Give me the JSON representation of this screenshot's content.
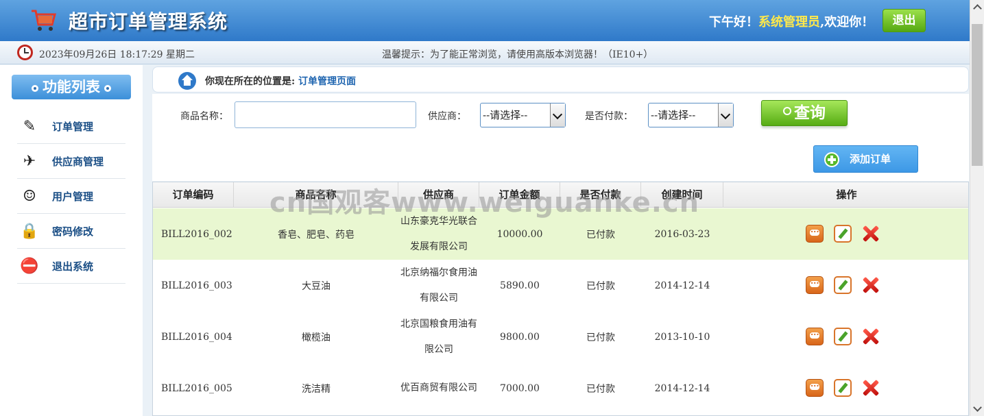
{
  "header": {
    "title": "超市订单管理系统",
    "greeting": "下午好！",
    "username": "系统管理员",
    "welcome": ",欢迎你！",
    "logout_label": "退出"
  },
  "subbar": {
    "datetime": "2023年09月26日 18:17:29 星期二",
    "tip": "温馨提示：为了能正常浏览，请使用高版本浏览器！（IE10+）"
  },
  "sidebar": {
    "title": "功能列表",
    "items": [
      {
        "label": "订单管理",
        "icon": "order-icon"
      },
      {
        "label": "供应商管理",
        "icon": "supplier-icon"
      },
      {
        "label": "用户管理",
        "icon": "users-icon"
      },
      {
        "label": "密码修改",
        "icon": "lock-icon"
      },
      {
        "label": "退出系统",
        "icon": "exit-icon"
      }
    ]
  },
  "breadcrumb": {
    "prefix": "你现在所在的位置是:",
    "current": "订单管理页面"
  },
  "search": {
    "product_label": "商品名称：",
    "product_value": "",
    "provider_label": "供应商：",
    "provider_selected": "--请选择--",
    "paid_label": "是否付款：",
    "paid_selected": "--请选择--",
    "query_label": "查询"
  },
  "add_button_label": "添加订单",
  "table": {
    "headers": [
      "订单编码",
      "商品名称",
      "供应商",
      "订单金额",
      "是否付款",
      "创建时间",
      "操作"
    ],
    "rows": [
      {
        "code": "BILL2016_002",
        "product": "香皂、肥皂、药皂",
        "provider": "山东豪克华光联合发展有限公司",
        "amount": "10000.00",
        "paid": "已付款",
        "created": "2016-03-23"
      },
      {
        "code": "BILL2016_003",
        "product": "大豆油",
        "provider": "北京纳福尔食用油有限公司",
        "amount": "5890.00",
        "paid": "已付款",
        "created": "2014-12-14"
      },
      {
        "code": "BILL2016_004",
        "product": "橄榄油",
        "provider": "北京国粮食用油有限公司",
        "amount": "9800.00",
        "paid": "已付款",
        "created": "2013-10-10"
      },
      {
        "code": "BILL2016_005",
        "product": "洗洁精",
        "provider": "优百商贸有限公司",
        "amount": "7000.00",
        "paid": "已付款",
        "created": "2014-12-14"
      }
    ]
  },
  "watermark": "cn国观客www.weiguanke.cn"
}
